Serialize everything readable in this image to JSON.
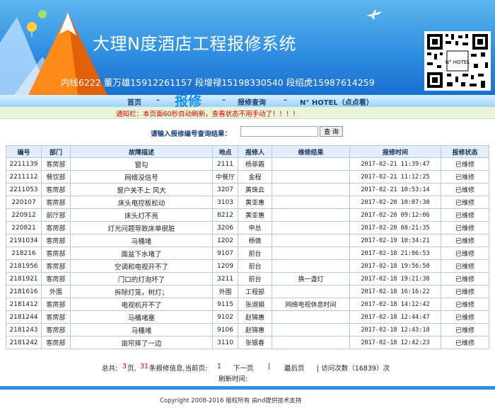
{
  "header": {
    "title": "大理N度酒店工程报修系统",
    "contact": "内线6222 董万雄15912261157 段增禄15198330540 段绍虎15987614259",
    "qr_caption": "N° HOTEL"
  },
  "nav": {
    "home": "首页",
    "sep1": "–",
    "repair": "报修",
    "sep2": "–",
    "query": "报修查询",
    "sep3": "–",
    "hotel": "N° HOTEL（点点看）"
  },
  "notice": "通知栏：本页面60秒自动刷新，查看状态不用手动了！！！！",
  "search": {
    "label": "请输入报修编号查询结果：",
    "value": "",
    "button": "查 询"
  },
  "table": {
    "columns": [
      "编号",
      "部门",
      "故障描述",
      "地点",
      "报修人",
      "维修结果",
      "报修时间",
      "报修状态"
    ],
    "rows": [
      [
        "2211139",
        "客房部",
        "窗勾",
        "2111",
        "杨菲霞",
        "",
        "2017-02-21 11:39:47",
        "已维修"
      ],
      [
        "2211112",
        "餐饮部",
        "网络没信号",
        "中餐厅",
        "金程",
        "",
        "2017-02-21 11:12:25",
        "已维修"
      ],
      [
        "2211053",
        "客房部",
        "窗户关不上 风大",
        "3207",
        "黄珠云",
        "",
        "2017-02-21 10:53:14",
        "已维修"
      ],
      [
        "220107",
        "客房部",
        "床头电控板松动",
        "3103",
        "黄亚惠",
        "",
        "2017-02-20 10:07:30",
        "已维修"
      ],
      [
        "220912",
        "前厅部",
        "床头灯不亮",
        "8212",
        "黄亚惠",
        "",
        "2017-02-20 09:12:06",
        "已维修"
      ],
      [
        "220821",
        "客房部",
        "灯光问题导致床单很脏",
        "3206",
        "申总",
        "",
        "2017-02-20 08:21:35",
        "已维修"
      ],
      [
        "2191034",
        "客房部",
        "马桶堵",
        "1202",
        "杨倩",
        "",
        "2017-02-19 10:34:21",
        "已维修"
      ],
      [
        "218216",
        "客房部",
        "面盆下水堵了",
        "9107",
        "前台",
        "",
        "2017-02-18 21:06:53",
        "已维修"
      ],
      [
        "2181956",
        "客房部",
        "空调和电视开不了",
        "1209",
        "前台",
        "",
        "2017-02-18 19:56:50",
        "已维修"
      ],
      [
        "2181921",
        "客房部",
        "门口的灯泡坏了",
        "3211",
        "前台",
        "换一盏灯",
        "2017-02-18 19:21:30",
        "已维修"
      ],
      [
        "2181616",
        "外围",
        "拆除灯笼，树灯；",
        "外围",
        "工程部",
        "",
        "2017-02-18 16:16:22",
        "已维修"
      ],
      [
        "2181412",
        "客房部",
        "电视机开不了",
        "9115",
        "张淑娟",
        "网络电视休息时间",
        "2017-02-18 14:12:42",
        "已维修"
      ],
      [
        "2181244",
        "客房部",
        "马桶堵塞",
        "9102",
        "赵锦惠",
        "",
        "2017-02-18 12:44:47",
        "已维修"
      ],
      [
        "2181243",
        "客房部",
        "马桶堵",
        "9106",
        "赵锦惠",
        "",
        "2017-02-18 12:43:18",
        "已维修"
      ],
      [
        "2181242",
        "客房部",
        "亩帘摔了一边",
        "3110",
        "张银春",
        "",
        "2017-02-18 12:42:23",
        "已维修"
      ]
    ]
  },
  "pager": {
    "total_prefix": "总共:",
    "pages": "3",
    "pages_suffix": "页,",
    "records": "31",
    "records_suffix": "条报修信息,当前页:",
    "current": "1",
    "next": "下一页",
    "sep": "|",
    "last": "最后页",
    "visits": "|  访问次数（16839）次"
  },
  "refresh_label": "刷新时间:",
  "footer": "Copyright 2008-2016 版权所有 由nd提供技术支持",
  "colors": {
    "banner": "#2f8fe0",
    "nav_active": "#1690e8",
    "notice": "#e00000"
  }
}
